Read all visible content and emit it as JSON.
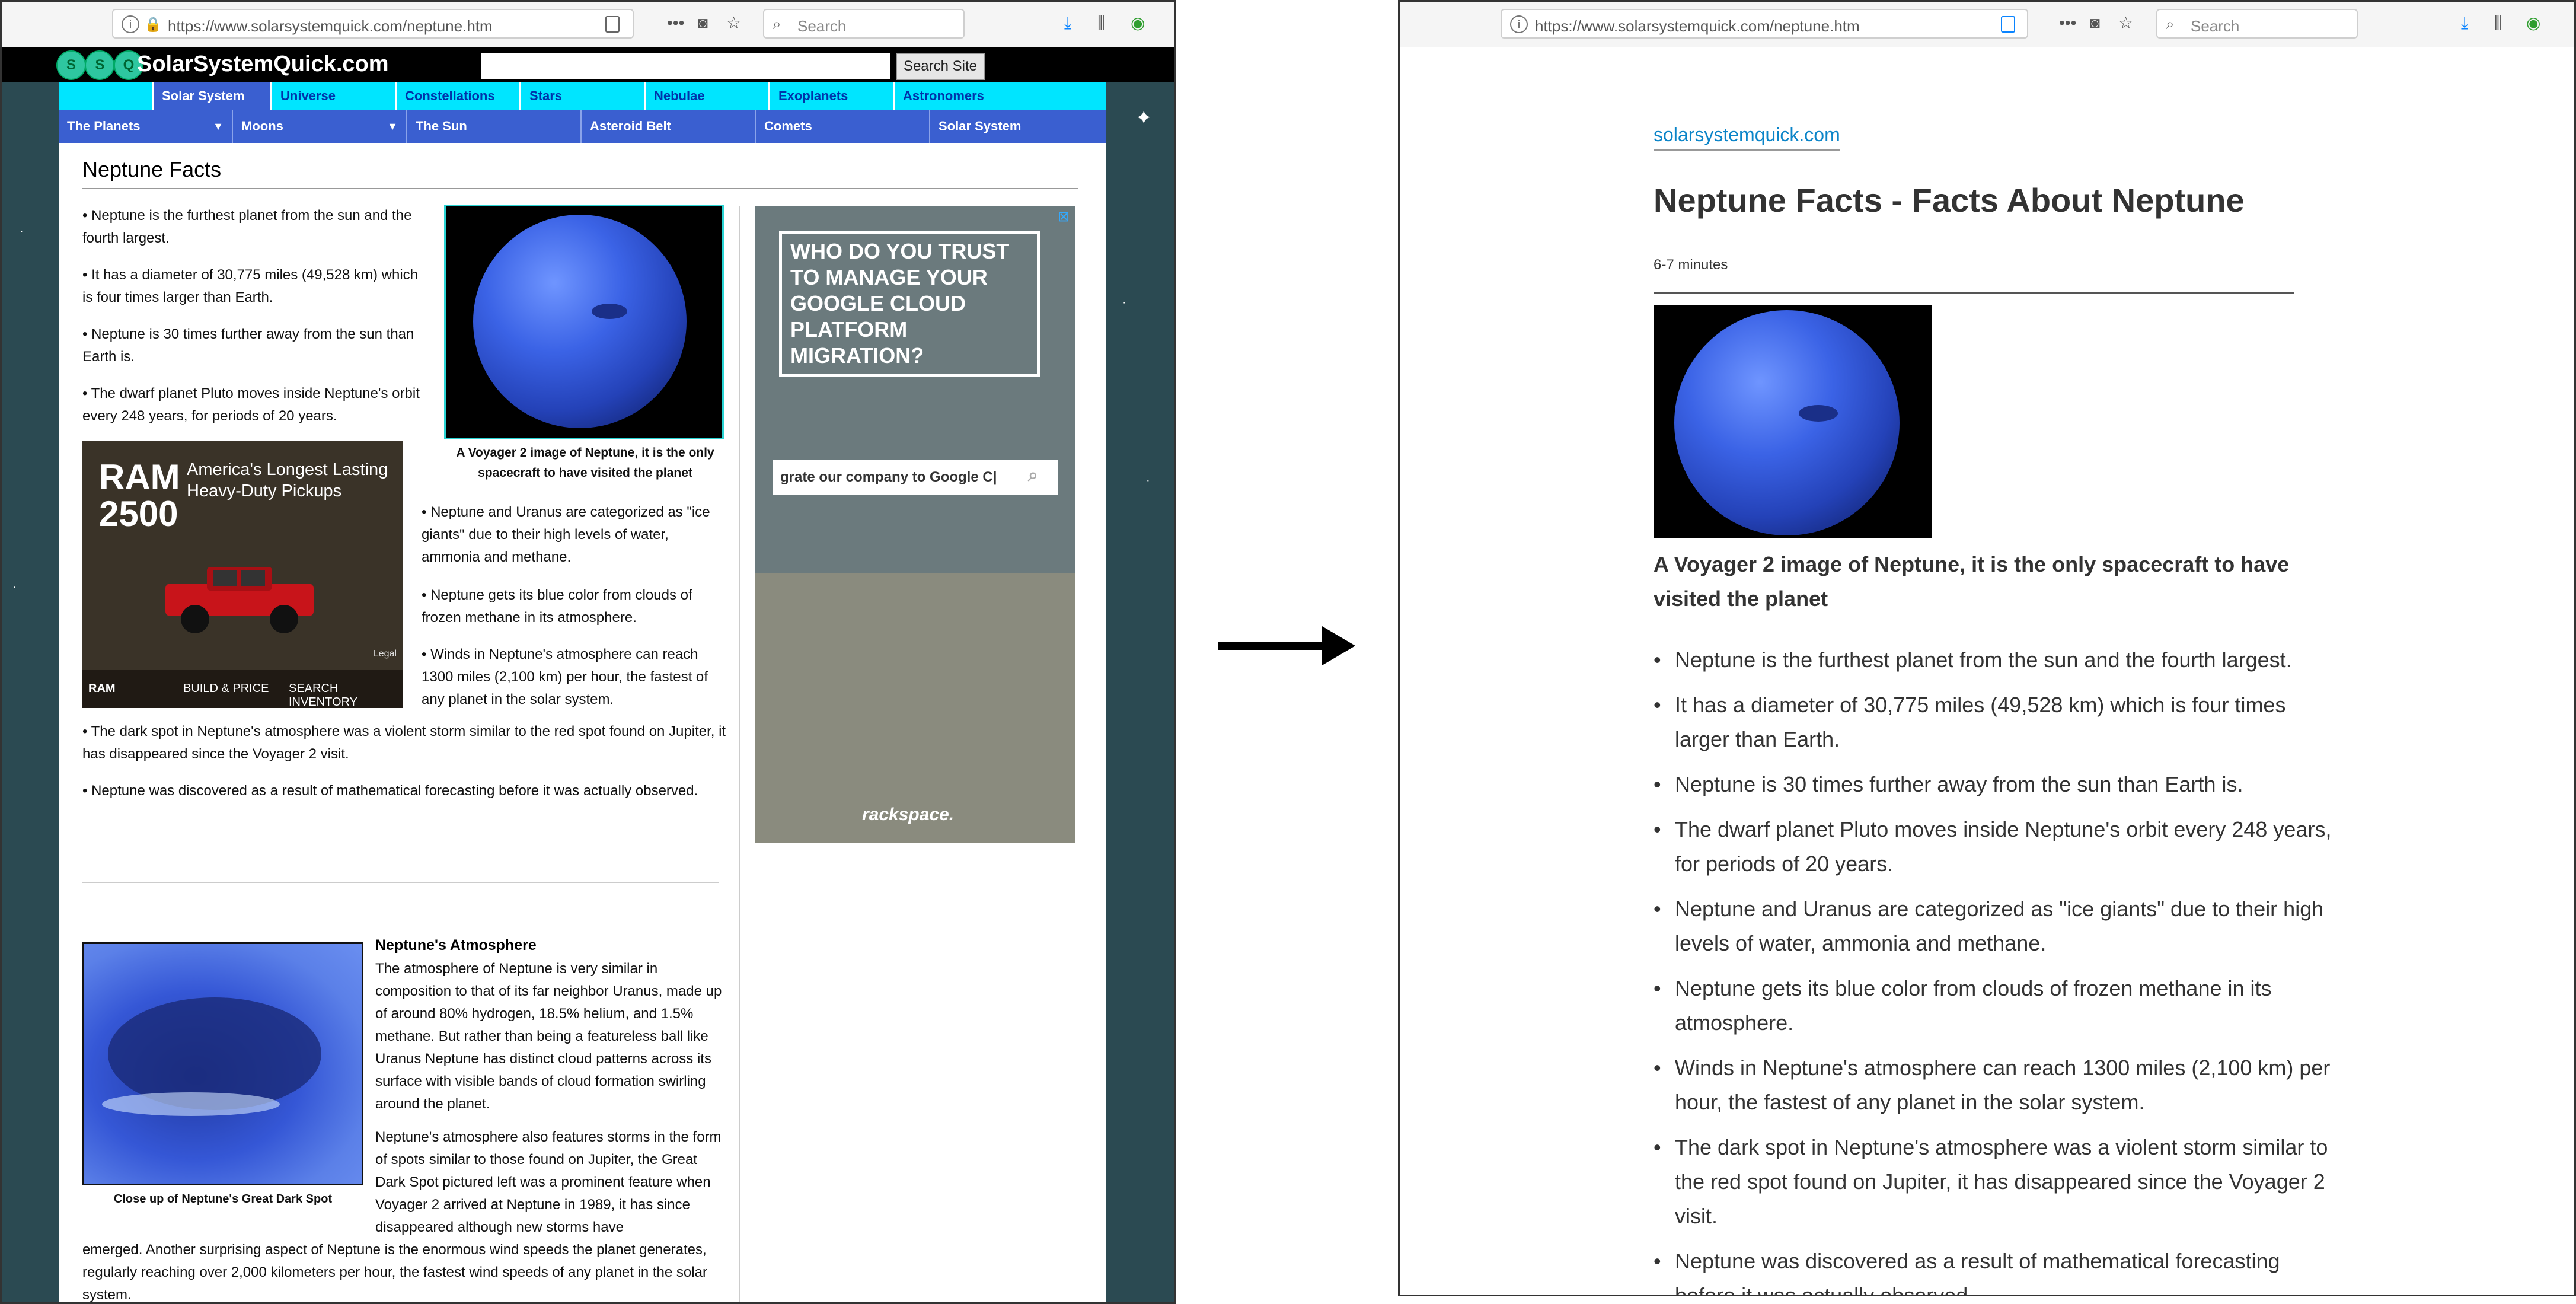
{
  "browser": {
    "url": "https://www.solarsystemquick.com/neptune.htm",
    "search_placeholder": "Search",
    "menu_icon": "ellipsis-icon",
    "icons": [
      "info-icon",
      "lock-icon",
      "reader-view-icon",
      "pocket-icon",
      "star-icon",
      "download-icon",
      "library-icon",
      "sync-icon"
    ]
  },
  "left_page": {
    "logo_letters": [
      "S",
      "S",
      "Q"
    ],
    "logo_text": "SolarSystemQuick.com",
    "search_button": "Search Site",
    "nav_tabs": [
      "Solar System",
      "Universe",
      "Constellations",
      "Stars",
      "Nebulae",
      "Exoplanets",
      "Astronomers"
    ],
    "subnav": [
      "The Planets",
      "Moons",
      "The Sun",
      "Asteroid Belt",
      "Comets",
      "Solar System"
    ],
    "title": "Neptune Facts",
    "facts_col1": [
      "Neptune is the furthest planet from the sun and the fourth largest.",
      "It has a diameter of 30,775 miles (49,528 km) which is four times larger than Earth.",
      "Neptune is 30 times further away from the sun than Earth is.",
      "The dwarf planet Pluto moves inside Neptune's orbit every 248 years, for periods of 20 years."
    ],
    "image_caption": "A Voyager 2 image of Neptune, it is the only spacecraft to have visited the planet",
    "facts_col2": [
      "Neptune and Uranus are categorized as \"ice giants\" due to their high levels of water, ammonia and methane.",
      "Neptune gets its blue color from clouds of frozen methane in its atmosphere.",
      "Winds in Neptune's atmosphere can reach 1300 miles (2,100 km) per hour, the fastest of any planet in the solar system."
    ],
    "facts_wide": [
      "The dark spot in Neptune's atmosphere was a violent storm similar to the red spot found on Jupiter, it has disappeared since the Voyager 2 visit.",
      "Neptune was discovered as a result of mathematical forecasting before it was actually observed."
    ],
    "ad_ram": {
      "brand": "RAM 2500",
      "tagline": "America's Longest Lasting Heavy-Duty Pickups",
      "legal": "Legal",
      "buttons": [
        "BUILD & PRICE",
        "SEARCH INVENTORY"
      ],
      "logo": "RAM"
    },
    "ad_rackspace": {
      "headline": "WHO DO YOU TRUST TO MANAGE YOUR GOOGLE CLOUD PLATFORM MIGRATION?",
      "search_text": "grate our company to Google C|",
      "brand": "rackspace."
    },
    "dark_spot_caption": "Close up of Neptune's Great Dark Spot",
    "atmosphere_heading": "Neptune's Atmosphere",
    "atmosphere_p1": "The atmosphere of Neptune is very similar in composition to that of its far neighbor Uranus, made up of around 80% hydrogen, 18.5% helium, and 1.5% methane. But rather than being a featureless ball like Uranus Neptune has distinct cloud patterns across its surface with visible bands of cloud formation swirling around the planet.",
    "atmosphere_p2": "Neptune's atmosphere also features storms in the form of spots similar to those found on Jupiter, the Great Dark Spot pictured left was a prominent feature when Voyager 2 arrived at Neptune in 1989, it has since disappeared although new storms have",
    "atmosphere_p3": "emerged. Another surprising aspect of Neptune is the enormous wind speeds the planet generates, regularly reaching over 2,000 kilometers per hour, the fastest wind speeds of any planet in the solar system."
  },
  "right_page": {
    "site": "solarsystemquick.com",
    "title": "Neptune Facts - Facts About Neptune",
    "read_time": "6-7 minutes",
    "caption": "A Voyager 2 image of Neptune, it is the only spacecraft to have visited the planet",
    "facts": [
      "Neptune is the furthest planet from the sun and the fourth largest.",
      "It has a diameter of 30,775 miles (49,528 km) which is four times larger than Earth.",
      "Neptune is 30 times further away from the sun than Earth is.",
      "The dwarf planet Pluto moves inside Neptune's orbit every 248 years, for periods of 20 years.",
      "Neptune and Uranus are categorized as \"ice giants\" due to their high levels of water, ammonia and methane.",
      "Neptune gets its blue color from clouds of frozen methane in its atmosphere.",
      "Winds in Neptune's atmosphere can reach 1300 miles (2,100 km) per hour, the fastest of any planet in the solar system.",
      "The dark spot in Neptune's atmosphere was a violent storm similar to the red spot found on Jupiter, it has disappeared since the Voyager 2 visit.",
      "Neptune was discovered as a result of mathematical forecasting before it was actually observed."
    ]
  },
  "colors": {
    "nav_cyan": "#00e5ff",
    "nav_blue": "#3a5fd0",
    "link_blue": "#0a84c8",
    "space_bg": "#2b4a52"
  }
}
